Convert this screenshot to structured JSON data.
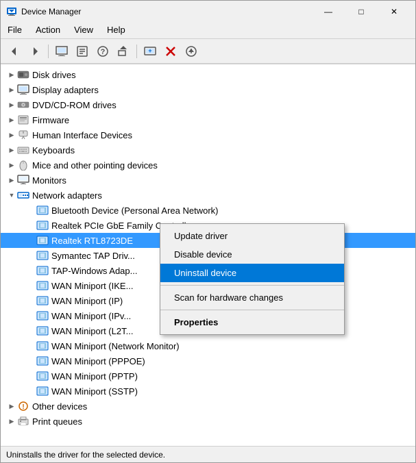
{
  "window": {
    "title": "Device Manager",
    "icon": "device-manager-icon"
  },
  "titlebar": {
    "minimize_label": "—",
    "maximize_label": "□",
    "close_label": "✕"
  },
  "menubar": {
    "items": [
      {
        "label": "File",
        "id": "file"
      },
      {
        "label": "Action",
        "id": "action"
      },
      {
        "label": "View",
        "id": "view"
      },
      {
        "label": "Help",
        "id": "help"
      }
    ]
  },
  "toolbar": {
    "buttons": [
      {
        "name": "back-btn",
        "icon": "◀",
        "label": "Back"
      },
      {
        "name": "forward-btn",
        "icon": "▶",
        "label": "Forward"
      },
      {
        "name": "computer-btn",
        "icon": "🖥",
        "label": "Computer"
      },
      {
        "name": "properties-btn",
        "icon": "📋",
        "label": "Properties"
      },
      {
        "name": "help-btn",
        "icon": "❓",
        "label": "Help"
      },
      {
        "name": "update-btn",
        "icon": "🔧",
        "label": "Update"
      },
      {
        "name": "adddevice-btn",
        "icon": "🖨",
        "label": "Add device"
      },
      {
        "name": "remove-btn",
        "icon": "✖",
        "label": "Remove"
      },
      {
        "name": "download-btn",
        "icon": "⬇",
        "label": "Download"
      }
    ]
  },
  "tree": {
    "items": [
      {
        "id": "disk-drives",
        "label": "Disk drives",
        "level": 1,
        "expanded": false,
        "icon": "disk"
      },
      {
        "id": "display-adapters",
        "label": "Display adapters",
        "level": 1,
        "expanded": false,
        "icon": "display"
      },
      {
        "id": "dvd-rom",
        "label": "DVD/CD-ROM drives",
        "level": 1,
        "expanded": false,
        "icon": "dvd"
      },
      {
        "id": "firmware",
        "label": "Firmware",
        "level": 1,
        "expanded": false,
        "icon": "firmware"
      },
      {
        "id": "hid",
        "label": "Human Interface Devices",
        "level": 1,
        "expanded": false,
        "icon": "hid"
      },
      {
        "id": "keyboards",
        "label": "Keyboards",
        "level": 1,
        "expanded": false,
        "icon": "keyboard"
      },
      {
        "id": "mice",
        "label": "Mice and other pointing devices",
        "level": 1,
        "expanded": false,
        "icon": "mouse"
      },
      {
        "id": "monitors",
        "label": "Monitors",
        "level": 1,
        "expanded": false,
        "icon": "monitor"
      },
      {
        "id": "network-adapters",
        "label": "Network adapters",
        "level": 1,
        "expanded": true,
        "icon": "network"
      },
      {
        "id": "bluetooth",
        "label": "Bluetooth Device (Personal Area Network)",
        "level": 2,
        "icon": "nic"
      },
      {
        "id": "realtek-gbe",
        "label": "Realtek PCIe GbE Family Controller",
        "level": 2,
        "icon": "nic"
      },
      {
        "id": "realtek-rtl",
        "label": "Realtek RTL8723DE",
        "level": 2,
        "icon": "nic",
        "selected": true
      },
      {
        "id": "symantec",
        "label": "Symantec TAP Driv...",
        "level": 2,
        "icon": "nic"
      },
      {
        "id": "tap-windows",
        "label": "TAP-Windows Adap...",
        "level": 2,
        "icon": "nic"
      },
      {
        "id": "wan-ike",
        "label": "WAN Miniport (IKE...",
        "level": 2,
        "icon": "nic"
      },
      {
        "id": "wan-ip",
        "label": "WAN Miniport (IP)",
        "level": 2,
        "icon": "nic"
      },
      {
        "id": "wan-ipv",
        "label": "WAN Miniport (IPv...",
        "level": 2,
        "icon": "nic"
      },
      {
        "id": "wan-l2t",
        "label": "WAN Miniport (L2T...",
        "level": 2,
        "icon": "nic"
      },
      {
        "id": "wan-network-monitor",
        "label": "WAN Miniport (Network Monitor)",
        "level": 2,
        "icon": "nic"
      },
      {
        "id": "wan-pppoe",
        "label": "WAN Miniport (PPPOE)",
        "level": 2,
        "icon": "nic"
      },
      {
        "id": "wan-pptp",
        "label": "WAN Miniport (PPTP)",
        "level": 2,
        "icon": "nic"
      },
      {
        "id": "wan-sstp",
        "label": "WAN Miniport (SSTP)",
        "level": 2,
        "icon": "nic"
      },
      {
        "id": "other-devices",
        "label": "Other devices",
        "level": 1,
        "expanded": false,
        "icon": "other"
      },
      {
        "id": "print-queues",
        "label": "Print queues",
        "level": 1,
        "expanded": false,
        "icon": "printer"
      }
    ]
  },
  "context_menu": {
    "items": [
      {
        "id": "update-driver",
        "label": "Update driver",
        "bold": false,
        "active": false
      },
      {
        "id": "disable-device",
        "label": "Disable device",
        "bold": false,
        "active": false
      },
      {
        "id": "uninstall-device",
        "label": "Uninstall device",
        "bold": false,
        "active": true
      },
      {
        "separator": true
      },
      {
        "id": "scan-hardware",
        "label": "Scan for hardware changes",
        "bold": false,
        "active": false
      },
      {
        "separator": true
      },
      {
        "id": "properties",
        "label": "Properties",
        "bold": true,
        "active": false
      }
    ]
  },
  "statusbar": {
    "text": "Uninstalls the driver for the selected device."
  }
}
